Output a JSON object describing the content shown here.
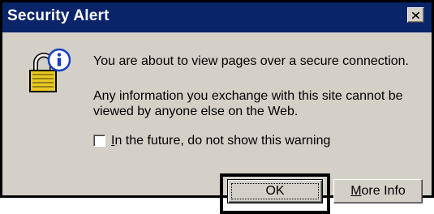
{
  "window": {
    "title": "Security Alert",
    "close_label": "×",
    "icon": "lock-info-icon"
  },
  "message": {
    "line1": "You are about to view pages over a secure connection.",
    "line2": "Any information you exchange with this site cannot be viewed by anyone else on the Web."
  },
  "checkbox": {
    "checked": false,
    "label_accel": "I",
    "label_rest": "n the future, do not show this warning"
  },
  "buttons": {
    "ok_label": "OK",
    "more_info_accel": "M",
    "more_info_rest": "ore Info"
  },
  "colors": {
    "titlebar": "#0a246a",
    "dialog_bg": "#d4d0c8",
    "highlight_border": "#000000"
  }
}
